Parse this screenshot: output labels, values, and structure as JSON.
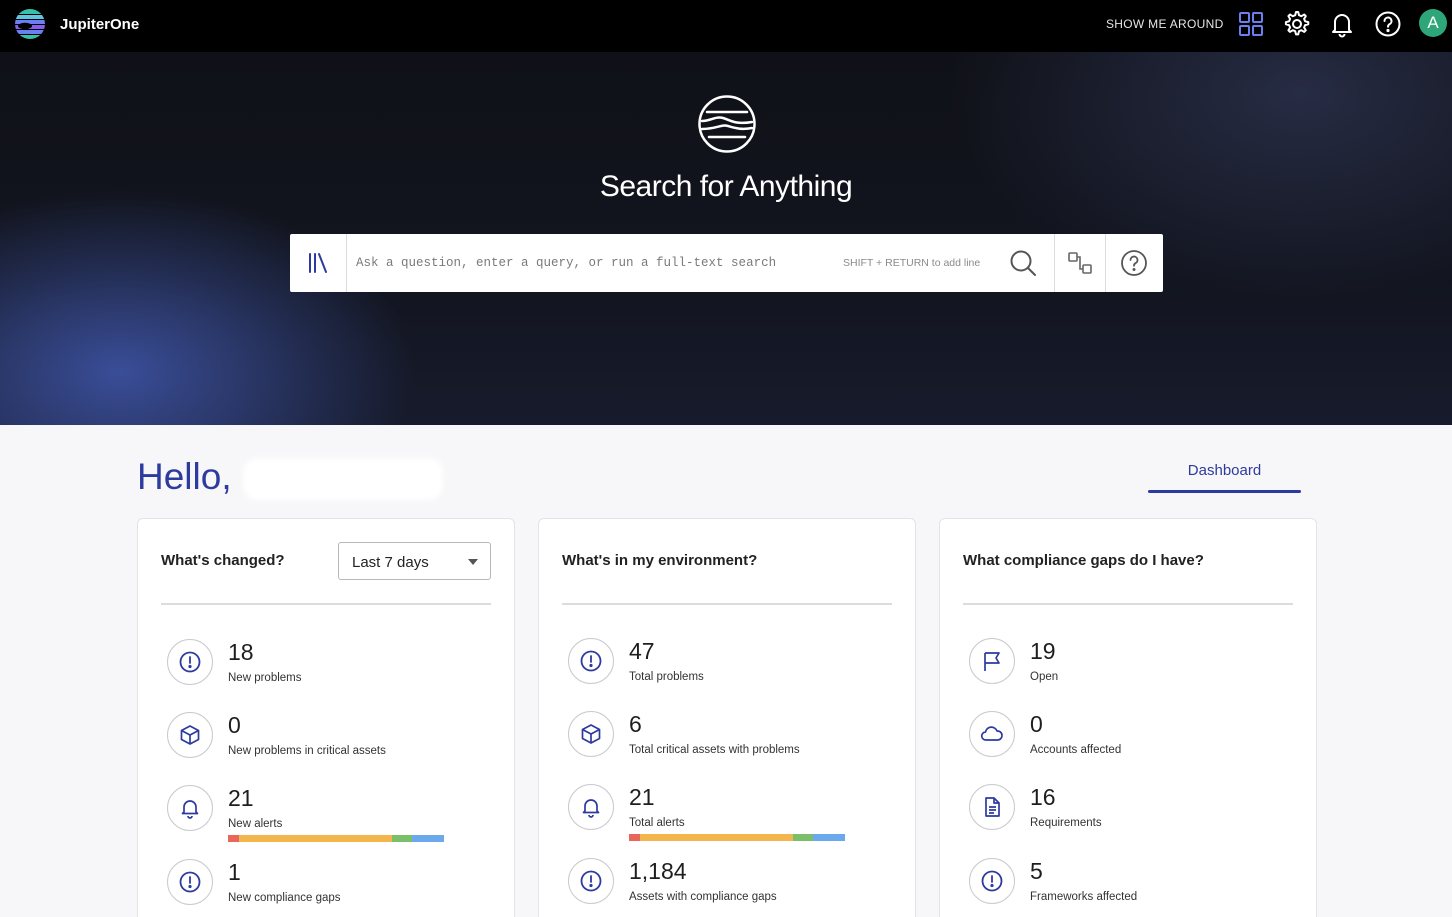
{
  "app": {
    "name": "JupiterOne"
  },
  "topbar": {
    "show_me_around": "SHOW ME AROUND",
    "avatar_initial": "A",
    "avatar_color": "#2fa57a"
  },
  "hero": {
    "title": "Search for Anything",
    "search_placeholder": "Ask a question, enter a query, or run a full-text search",
    "search_hint": "SHIFT + RETURN to add line"
  },
  "greeting": {
    "text": "Hello,"
  },
  "tabs": [
    {
      "label": "Dashboard",
      "active": true
    }
  ],
  "colors": {
    "accent": "#2d3b9e"
  },
  "cards": [
    {
      "title": "What's changed?",
      "period": "Last 7 days",
      "metrics": [
        {
          "value": "18",
          "label": "New problems",
          "icon": "alert-circle-icon"
        },
        {
          "value": "0",
          "label": "New problems in critical assets",
          "icon": "cube-icon"
        },
        {
          "value": "21",
          "label": "New alerts",
          "icon": "bell-icon",
          "severity": [
            {
              "color": "#e8665a",
              "pct": 5
            },
            {
              "color": "#f4b54c",
              "pct": 71
            },
            {
              "color": "#7cbf6b",
              "pct": 9
            },
            {
              "color": "#6aa9ec",
              "pct": 15
            }
          ]
        },
        {
          "value": "1",
          "label": "New compliance gaps",
          "icon": "alert-circle-icon"
        }
      ]
    },
    {
      "title": "What's in my environment?",
      "metrics": [
        {
          "value": "47",
          "label": "Total problems",
          "icon": "alert-circle-icon"
        },
        {
          "value": "6",
          "label": "Total critical assets with problems",
          "icon": "cube-icon"
        },
        {
          "value": "21",
          "label": "Total alerts",
          "icon": "bell-icon",
          "severity": [
            {
              "color": "#e8665a",
              "pct": 5
            },
            {
              "color": "#f4b54c",
              "pct": 71
            },
            {
              "color": "#7cbf6b",
              "pct": 9
            },
            {
              "color": "#6aa9ec",
              "pct": 15
            }
          ]
        },
        {
          "value": "1,184",
          "label": "Assets with compliance gaps",
          "icon": "alert-circle-icon"
        }
      ]
    },
    {
      "title": "What compliance gaps do I have?",
      "metrics": [
        {
          "value": "19",
          "label": "Open",
          "icon": "flag-icon"
        },
        {
          "value": "0",
          "label": "Accounts affected",
          "icon": "cloud-icon"
        },
        {
          "value": "16",
          "label": "Requirements",
          "icon": "document-icon"
        },
        {
          "value": "5",
          "label": "Frameworks affected",
          "icon": "alert-circle-icon"
        }
      ]
    }
  ]
}
